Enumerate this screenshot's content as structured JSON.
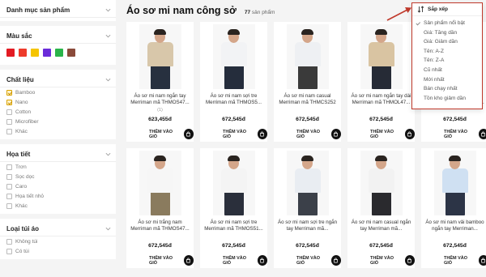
{
  "sidebar": {
    "category": {
      "title": "Danh mục sản phẩm"
    },
    "color": {
      "title": "Màu sắc",
      "swatches": [
        "#e31b23",
        "#ee3b2b",
        "#f5c400",
        "#6a2bd9",
        "#2ab44a",
        "#8a4a3a"
      ]
    },
    "material": {
      "title": "Chất liệu",
      "options": [
        {
          "label": "Bamboo",
          "checked": true
        },
        {
          "label": "Nano",
          "checked": true
        },
        {
          "label": "Cotton",
          "checked": false
        },
        {
          "label": "Microfiber",
          "checked": false
        },
        {
          "label": "Khác",
          "checked": false
        }
      ]
    },
    "pattern": {
      "title": "Họa tiết",
      "options": [
        {
          "label": "Trơn"
        },
        {
          "label": "Sọc dọc"
        },
        {
          "label": "Caro"
        },
        {
          "label": "Họa tiết nhỏ"
        },
        {
          "label": "Khác"
        }
      ]
    },
    "pocket": {
      "title": "Loại túi áo",
      "options": [
        {
          "label": "Không túi"
        },
        {
          "label": "Có túi"
        }
      ]
    }
  },
  "main": {
    "title": "Áo sơ mi nam công sở",
    "count_number": "77",
    "count_label": "sản phẩm"
  },
  "products": [
    {
      "name": "Áo sơ mi nam ngắn tay Merriman mã THMOS47...",
      "reviews": "(1)",
      "price": "623,455đ",
      "add": "THÊM VÀO GIỎ",
      "shirt": "#d8c7aa",
      "pants": "#27303f"
    },
    {
      "name": "Áo sơ mi nam sợi tre Merriman mã THMOS5...",
      "reviews": "",
      "price": "672,545đ",
      "add": "THÊM VÀO GIỎ",
      "shirt": "#f2f3f5",
      "pants": "#252d3c"
    },
    {
      "name": "Áo sơ mi nam casual Merriman mã THMCS252",
      "reviews": "",
      "price": "672,545đ",
      "add": "THÊM VÀO GIỎ",
      "shirt": "#eef0f3",
      "pants": "#3a3a3a"
    },
    {
      "name": "Áo sơ mi nam ngắn tay dài Merriman mã THMOL47...",
      "reviews": "",
      "price": "672,545đ",
      "add": "THÊM VÀO GIỎ",
      "shirt": "#d9c4a2",
      "pants": "#262b36"
    },
    {
      "name": "Áo sơ mi nam ngắn tay Merriman mã THMOS47...",
      "reviews": "",
      "price": "672,545đ",
      "add": "THÊM VÀO GIỎ",
      "shirt": "#ece9e2",
      "pants": "#2d3340"
    },
    {
      "name": "Áo sơ mi trắng nam Merriman mã THMOS47...",
      "reviews": "",
      "price": "672,545đ",
      "add": "THÊM VÀO GIỎ",
      "shirt": "#f6f6f6",
      "pants": "#8a7b5e"
    },
    {
      "name": "Áo sơ mi nam sợi tre Merriman mã THMOS51...",
      "reviews": "",
      "price": "672,545đ",
      "add": "THÊM VÀO GIỎ",
      "shirt": "#f4f4f4",
      "pants": "#2a2f3b"
    },
    {
      "name": "Áo sơ mi nam sợi tre ngắn tay Merriman mã...",
      "reviews": "",
      "price": "672,545đ",
      "add": "THÊM VÀO GIỎ",
      "shirt": "#e9edf2",
      "pants": "#3b4049"
    },
    {
      "name": "Áo sơ mi nam casual ngắn tay Merriman mã...",
      "reviews": "",
      "price": "672,545đ",
      "add": "THÊM VÀO GIỎ",
      "shirt": "#f2f2f2",
      "pants": "#2a2a2e"
    },
    {
      "name": "Áo sơ mi nam vải bamboo ngắn tay Merriman...",
      "reviews": "",
      "price": "672,545đ",
      "add": "THÊM VÀO GIỎ",
      "shirt": "#cfe0f2",
      "pants": "#2c3446"
    }
  ],
  "sort": {
    "label": "Sắp xếp",
    "options": [
      {
        "label": "Sản phẩm nổi bật",
        "selected": true
      },
      {
        "label": "Giá: Tăng dần",
        "selected": false
      },
      {
        "label": "Giá: Giảm dần",
        "selected": false
      },
      {
        "label": "Tên: A-Z",
        "selected": false
      },
      {
        "label": "Tên: Z-A",
        "selected": false
      },
      {
        "label": "Cũ nhất",
        "selected": false
      },
      {
        "label": "Mới nhất",
        "selected": false
      },
      {
        "label": "Bán chạy nhất",
        "selected": false
      },
      {
        "label": "Tồn kho giảm dần",
        "selected": false
      }
    ]
  },
  "colors": {
    "accent_red": "#c0392b",
    "checkbox_gold": "#d9a300"
  }
}
